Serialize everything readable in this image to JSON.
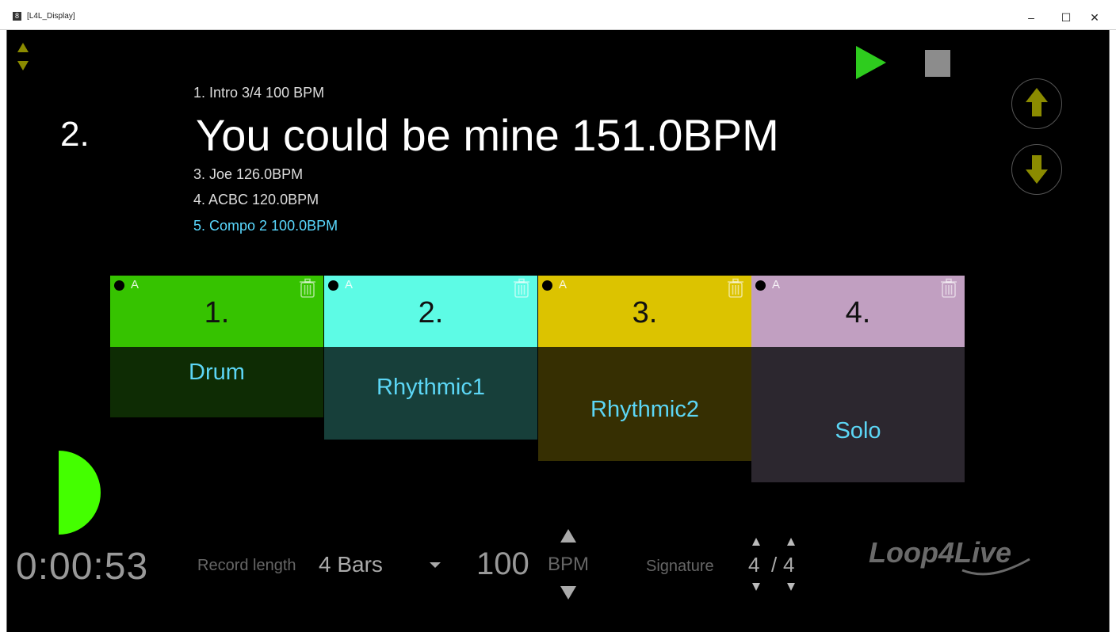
{
  "window": {
    "title": "[L4L_Display]",
    "minimize_glyph": "–",
    "maximize_glyph": "☐",
    "close_glyph": "✕"
  },
  "setlist": {
    "previous": "1. Intro 3/4 100 BPM",
    "current_number": "2.",
    "current": "You could be mine 151.0BPM",
    "next": [
      "3. Joe 126.0BPM",
      "4. ACBC 120.0BPM",
      "5. Compo 2 100.0BPM"
    ]
  },
  "transport": {
    "play_icon": "play-icon",
    "stop_icon": "stop-icon",
    "song_up_icon": "arrow-up-icon",
    "song_down_icon": "arrow-down-icon"
  },
  "tracks": [
    {
      "number": "1.",
      "auto": "A",
      "name": "Drum",
      "head_color": "#36c300",
      "body_color": "#0e2c04"
    },
    {
      "number": "2.",
      "auto": "A",
      "name": "Rhythmic1",
      "head_color": "#5dfbe5",
      "body_color": "#173f3a"
    },
    {
      "number": "3.",
      "auto": "A",
      "name": "Rhythmic2",
      "head_color": "#dcc300",
      "body_color": "#362f02"
    },
    {
      "number": "4.",
      "auto": "A",
      "name": "Solo",
      "head_color": "#c19fc1",
      "body_color": "#2c272f"
    }
  ],
  "metronome": {
    "color": "#44ff00"
  },
  "bottom": {
    "timer": "0:00:53",
    "record_label": "Record length",
    "record_value": "4 Bars",
    "bpm_value": "100",
    "bpm_unit": "BPM",
    "signature_label": "Signature",
    "signature_num": "4",
    "signature_slash": "/",
    "signature_den": "4",
    "logo_text": "Loop4Live"
  },
  "colors": {
    "accent_olive": "#8b8b00",
    "play_green": "#2ecc1e",
    "stop_gray": "#8c8c8c",
    "next_song_highlight": "#5ad9ff"
  }
}
